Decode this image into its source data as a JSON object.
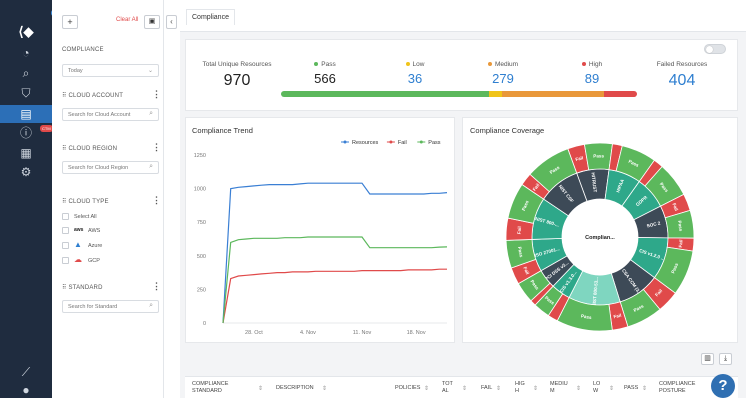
{
  "sidebar": {
    "icons": [
      "logo-icon",
      "gauge-icon",
      "search-icon",
      "shield-icon",
      "compliance-icon",
      "alert-icon",
      "server-icon",
      "settings-icon",
      "rocket-icon",
      "user-icon"
    ],
    "alert_badge": "CTM"
  },
  "filters": {
    "clear_all": "Clear All",
    "compliance_label": "COMPLIANCE",
    "compliance_value": "Today",
    "cloud_account_label": "CLOUD ACCOUNT",
    "cloud_account_placeholder": "Search for Cloud Account",
    "cloud_region_label": "CLOUD REGION",
    "cloud_region_placeholder": "Search for Cloud Region",
    "cloud_type_label": "CLOUD TYPE",
    "cloud_types": [
      "Select All",
      "AWS",
      "Azure",
      "GCP"
    ],
    "standard_label": "STANDARD",
    "standard_placeholder": "Search for Standard"
  },
  "tabs": [
    "Compliance"
  ],
  "summary": {
    "total_label": "Total Unique Resources",
    "total_value": "970",
    "pass_label": "Pass",
    "pass_value": "566",
    "low_label": "Low",
    "low_value": "36",
    "medium_label": "Medium",
    "medium_value": "279",
    "high_label": "High",
    "high_value": "89",
    "failed_label": "Failed Resources",
    "failed_value": "404",
    "colors": {
      "pass": "#5cb85c",
      "low": "#f0c419",
      "medium": "#e9983a",
      "high": "#e04a4a",
      "accent": "#2f7fd0"
    }
  },
  "trend": {
    "title": "Compliance Trend",
    "chart_data": {
      "type": "line",
      "x": [
        "24 Oct",
        "25 Oct",
        "26 Oct",
        "27 Oct",
        "28 Oct",
        "29 Oct",
        "30 Oct",
        "31 Oct",
        "1 Nov",
        "2 Nov",
        "3 Nov",
        "4 Nov",
        "5 Nov",
        "6 Nov",
        "7 Nov",
        "8 Nov",
        "9 Nov",
        "10 Nov",
        "11 Nov",
        "12 Nov",
        "13 Nov",
        "14 Nov",
        "15 Nov",
        "16 Nov",
        "17 Nov",
        "18 Nov",
        "19 Nov",
        "20 Nov",
        "21 Nov",
        "22 Nov"
      ],
      "xticks": [
        "28. Oct",
        "4. Nov",
        "11. Nov",
        "18. Nov"
      ],
      "yticks": [
        0,
        250,
        500,
        750,
        1000,
        1250
      ],
      "ylim": [
        0,
        1250
      ],
      "series": [
        {
          "name": "Resources",
          "color": "#3a7fd4",
          "values": [
            0,
            1000,
            1010,
            1015,
            1020,
            1025,
            1030,
            1030,
            1030,
            1030,
            1035,
            1040,
            1040,
            1040,
            1040,
            1040,
            1040,
            1040,
            1040,
            960,
            960,
            960,
            960,
            960,
            960,
            960,
            960,
            965,
            965,
            970
          ]
        },
        {
          "name": "Fail",
          "color": "#e04a4a",
          "values": [
            0,
            330,
            350,
            355,
            360,
            365,
            370,
            375,
            375,
            380,
            380,
            380,
            385,
            385,
            385,
            385,
            385,
            385,
            390,
            390,
            390,
            390,
            390,
            390,
            395,
            395,
            395,
            395,
            400,
            400
          ]
        },
        {
          "name": "Pass",
          "color": "#5cb85c",
          "values": [
            0,
            600,
            620,
            625,
            630,
            630,
            630,
            630,
            635,
            635,
            635,
            640,
            640,
            640,
            640,
            640,
            640,
            640,
            640,
            560,
            560,
            560,
            560,
            560,
            560,
            560,
            560,
            560,
            565,
            566
          ]
        }
      ]
    }
  },
  "coverage": {
    "title": "Compliance Coverage",
    "center_label": "Complian...",
    "inner": [
      {
        "label": "HITRUST",
        "color": "#3d4a57",
        "span": 1
      },
      {
        "label": "HIPAA",
        "color": "#2ea88a",
        "span": 1
      },
      {
        "label": "GDPR",
        "color": "#2ea88a",
        "span": 1
      },
      {
        "label": "SOC 2",
        "color": "#3d4a57",
        "span": 1
      },
      {
        "label": "CIS v1.2.0 ...",
        "color": "#2ea88a",
        "span": 1.3
      },
      {
        "label": "CSA CCM (3...",
        "color": "#3d4a57",
        "span": 1.3
      },
      {
        "label": "NIST 800-53...",
        "color": "#7fd6c0",
        "span": 1.6
      },
      {
        "label": "CIS v1.3.0...",
        "color": "#2ea88a",
        "span": 0.6
      },
      {
        "label": "PCI DSS v3...",
        "color": "#3d4a57",
        "span": 0.6
      },
      {
        "label": "ISO 27001...",
        "color": "#2ea88a",
        "span": 1
      },
      {
        "label": "NIST 800-...",
        "color": "#2ea88a",
        "span": 1.3
      },
      {
        "label": "NIST CSF",
        "color": "#3d4a57",
        "span": 1.3
      }
    ],
    "outer_pass": "Pass",
    "outer_fail": "Fail",
    "pass_color": "#5cb85c",
    "fail_color": "#e04a4a"
  },
  "table": {
    "columns": [
      "COMPLIANCE STANDARD",
      "DESCRIPTION",
      "POLICIES",
      "TOTAL",
      "FAIL",
      "HIGH",
      "MEDIUM",
      "LOW",
      "PASS",
      "COMPLIANCE POSTURE"
    ],
    "help": "?"
  }
}
